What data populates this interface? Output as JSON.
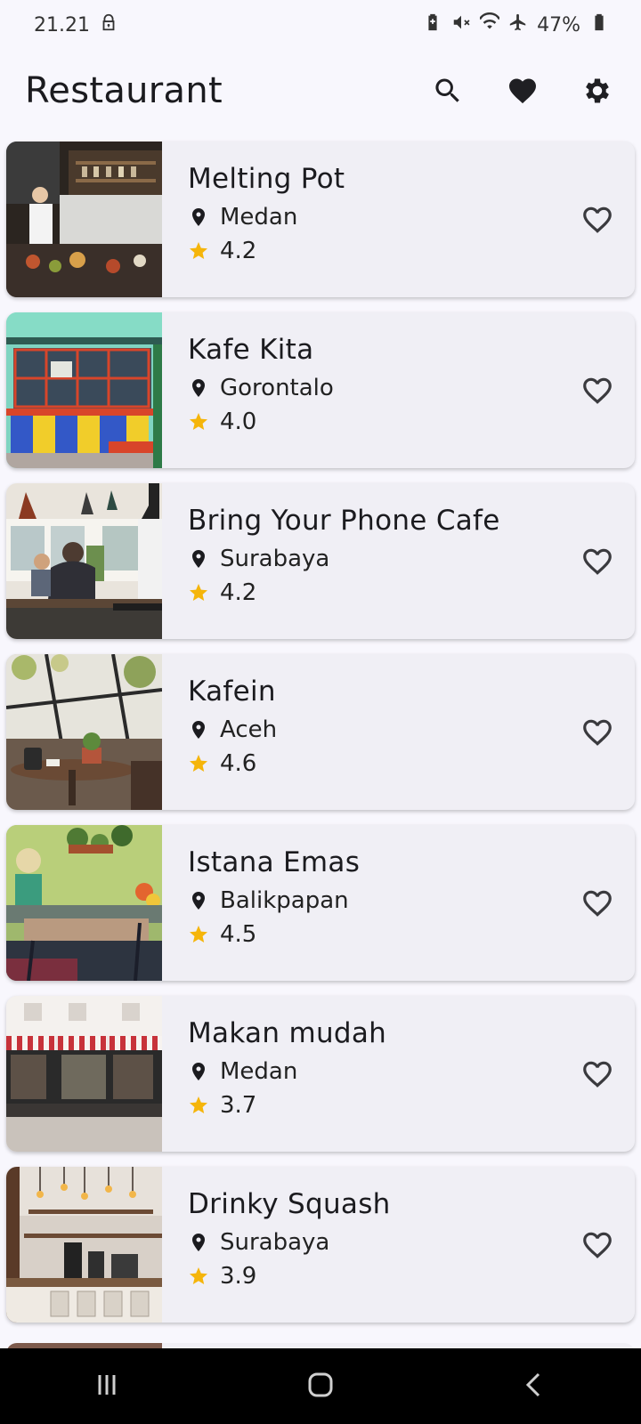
{
  "status_bar": {
    "time": "21.21",
    "battery": "47%",
    "icons": [
      "lock-icon",
      "battery-saver-icon",
      "mute-icon",
      "wifi-icon",
      "airplane-icon",
      "battery-icon"
    ]
  },
  "app_bar": {
    "title": "Restaurant",
    "actions": [
      "search-icon",
      "favorite-icon",
      "settings-icon"
    ]
  },
  "restaurants": [
    {
      "name": "Melting Pot",
      "city": "Medan",
      "rating": "4.2"
    },
    {
      "name": "Kafe Kita",
      "city": "Gorontalo",
      "rating": "4.0"
    },
    {
      "name": "Bring Your Phone Cafe",
      "city": "Surabaya",
      "rating": "4.2"
    },
    {
      "name": "Kafein",
      "city": "Aceh",
      "rating": "4.6"
    },
    {
      "name": "Istana Emas",
      "city": "Balikpapan",
      "rating": "4.5"
    },
    {
      "name": "Makan mudah",
      "city": "Medan",
      "rating": "3.7"
    },
    {
      "name": "Drinky Squash",
      "city": "Surabaya",
      "rating": "3.9"
    }
  ],
  "colors": {
    "background": "#f8f7fd",
    "card": "#f0eff5",
    "star": "#f5b50a",
    "text": "#1b1b1f"
  },
  "nav_bar": {
    "buttons": [
      "recents-icon",
      "home-icon",
      "back-icon"
    ]
  }
}
